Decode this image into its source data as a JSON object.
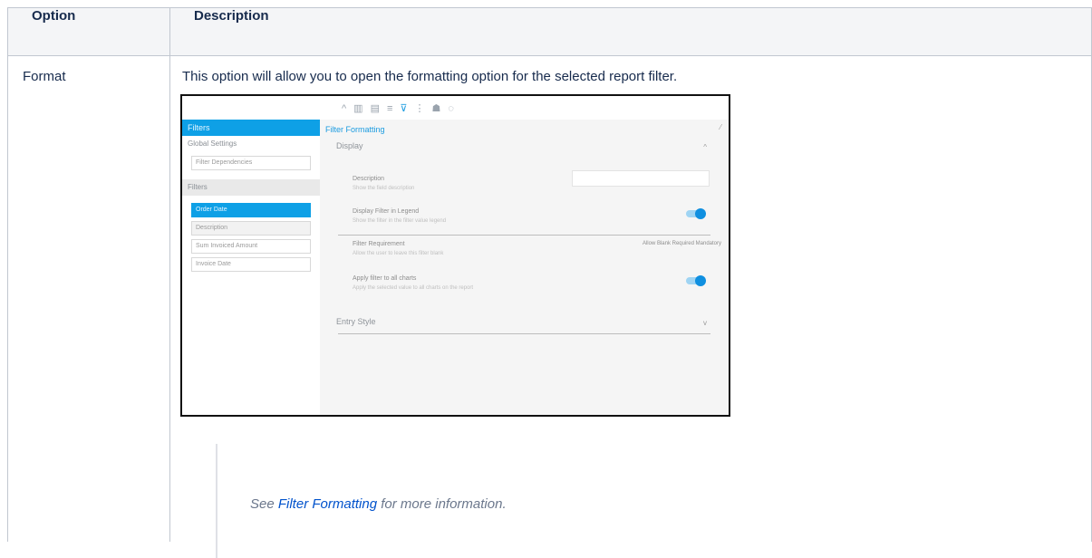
{
  "table": {
    "headers": [
      "Option",
      "Description"
    ],
    "rows": [
      {
        "option": "Format",
        "description": "This option will allow you to open the formatting option for the selected report filter."
      }
    ]
  },
  "note": {
    "prefix": "See ",
    "link_text": "Filter Formatting",
    "suffix": " for more information."
  },
  "screenshot": {
    "left_header": "Filters",
    "left_row1": "Global Settings",
    "left_pill1": "Filter Dependencies",
    "left_section": "Filters",
    "filters": [
      "Order Date",
      "Description",
      "Sum Invoiced Amount",
      "Invoice Date"
    ],
    "right_title": "Filter Formatting",
    "display_section": "Display",
    "description_label": "Description",
    "description_sub": "Show the field description",
    "legend_label": "Display Filter in Legend",
    "legend_sub": "Show the filter in the filter value legend",
    "requirement_label": "Filter Requirement",
    "requirement_sub": "Allow the user to leave this filter blank",
    "requirement_options": "Allow Blank  Required  Mandatory",
    "lower_label": "Apply filter to all charts",
    "lower_sub": "Apply the selected value to all charts on the report",
    "entry_section": "Entry Style",
    "colors": {
      "accent": "#0ea0e6",
      "link": "#0052cc"
    }
  }
}
